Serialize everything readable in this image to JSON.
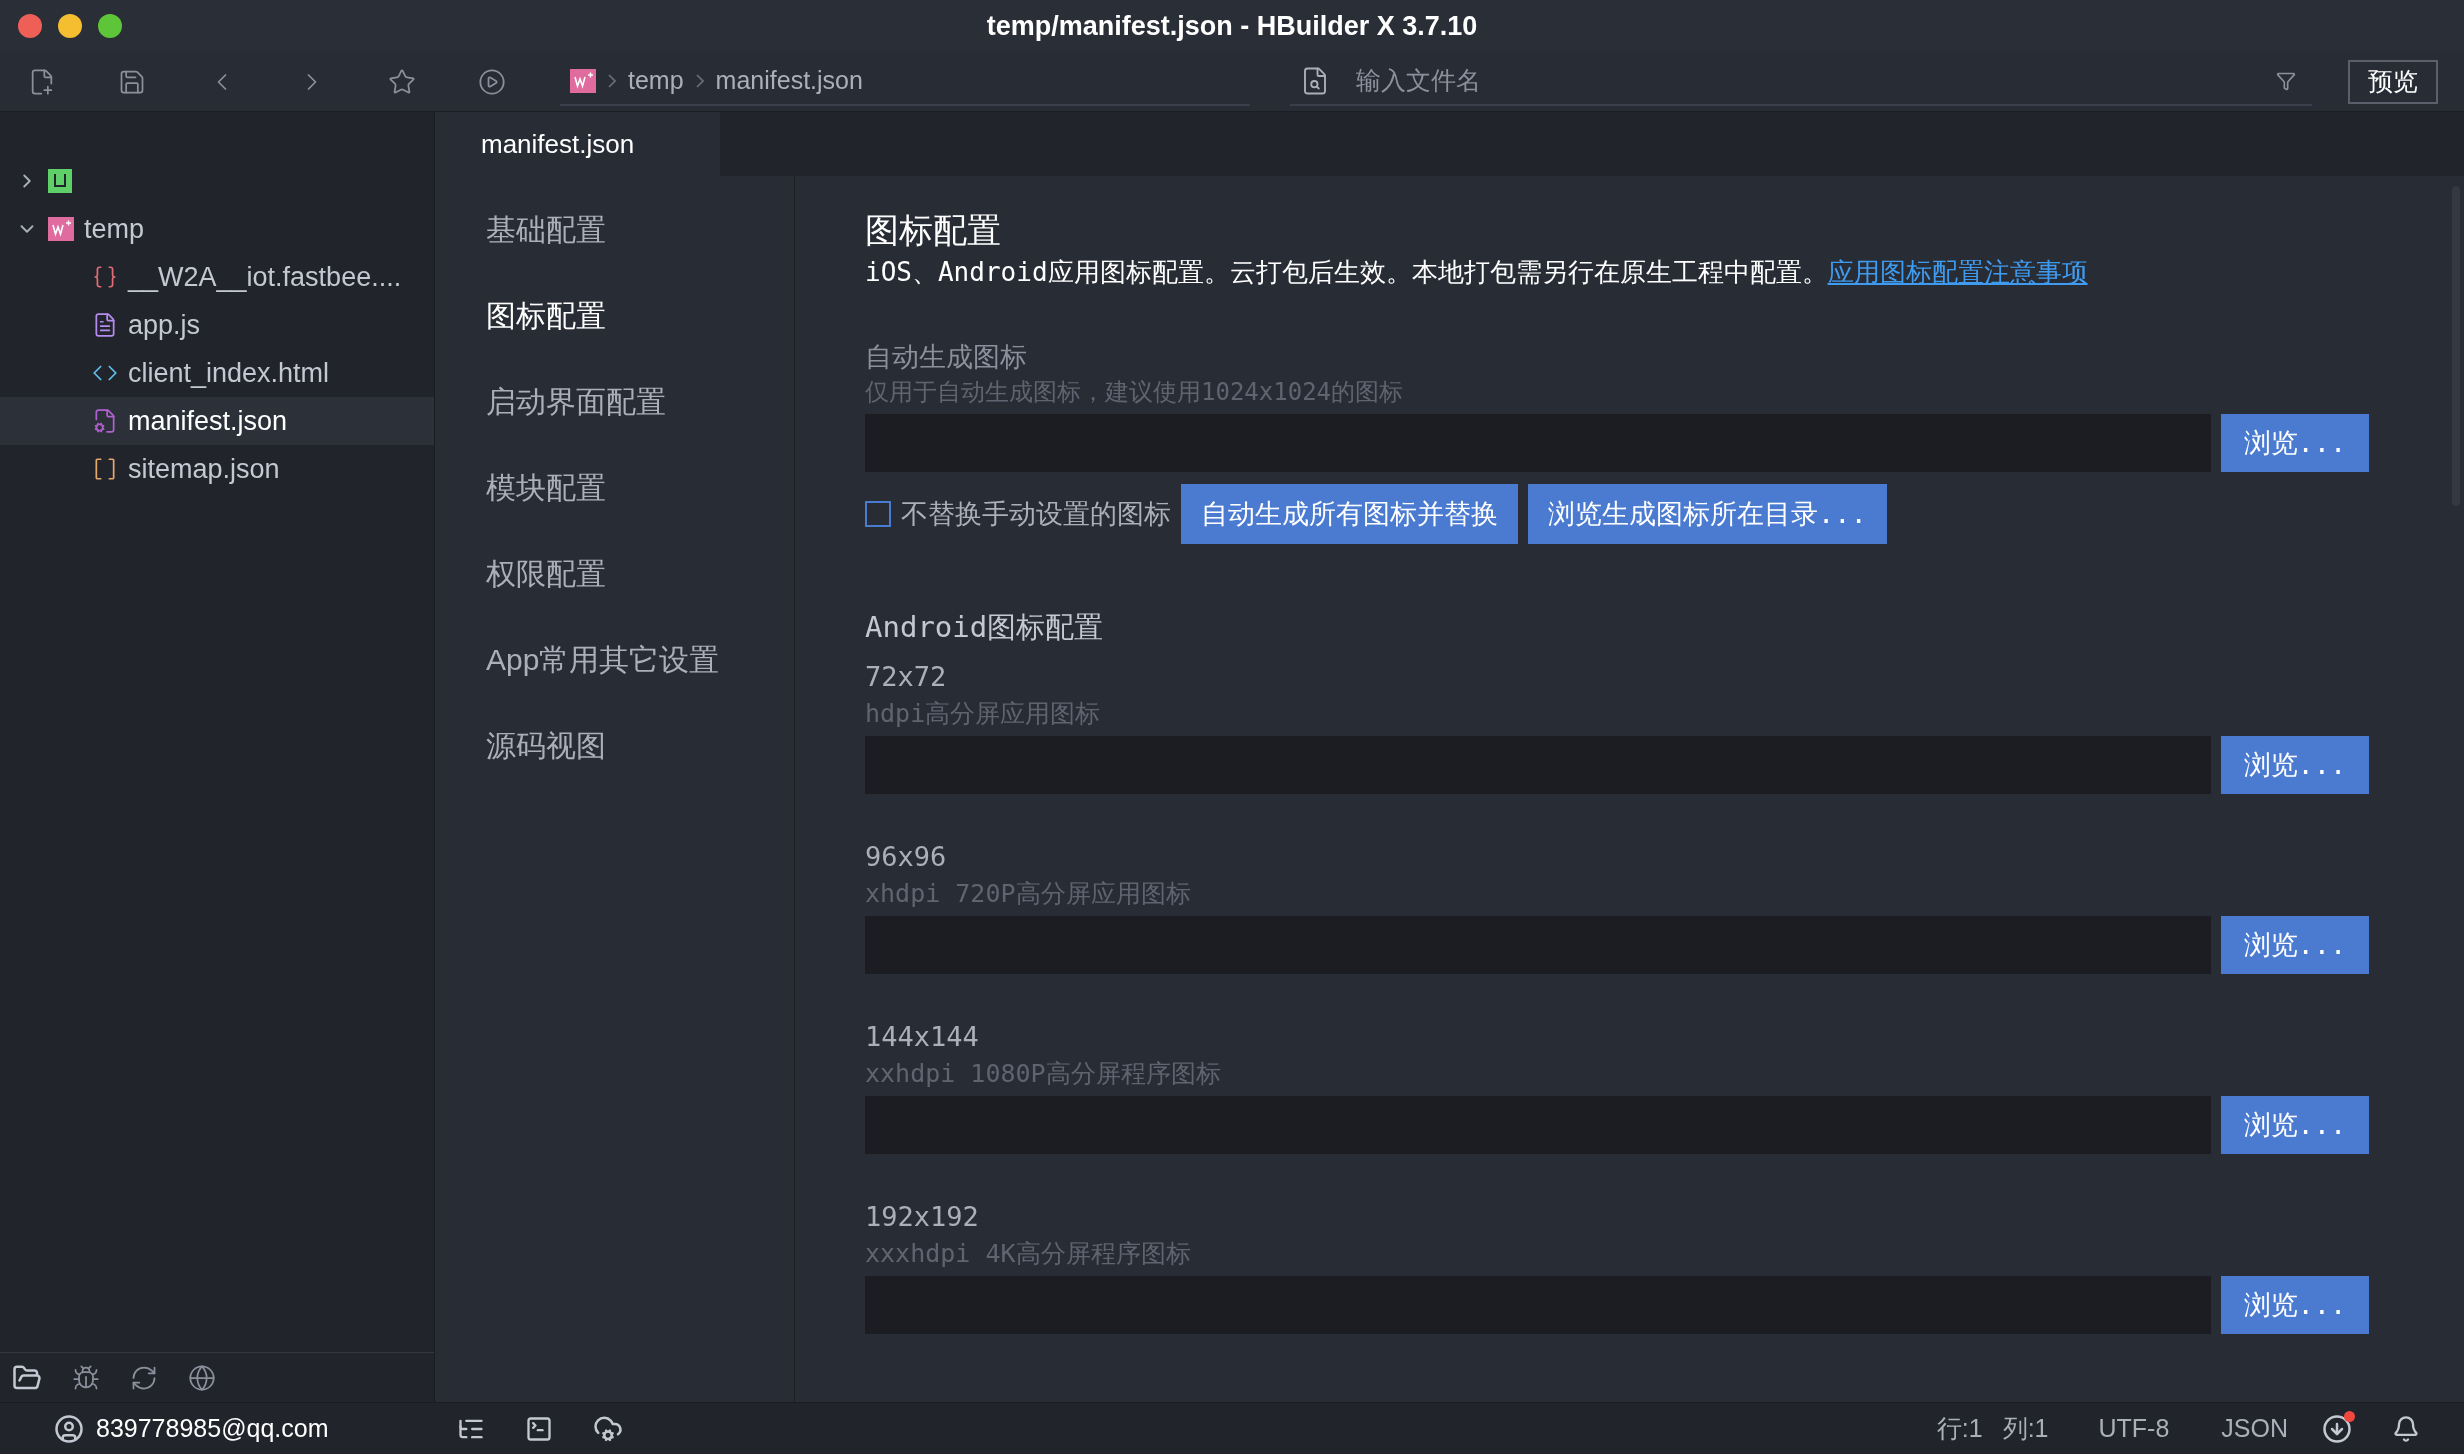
{
  "window": {
    "title": "temp/manifest.json - HBuilder X 3.7.10"
  },
  "toolbar": {
    "breadcrumb": [
      "temp",
      "manifest.json"
    ],
    "search": {
      "placeholder": "输入文件名"
    },
    "preview_button": "预览"
  },
  "project_tree": [
    {
      "kind": "uniapp",
      "expanded": false,
      "selected": false
    },
    {
      "kind": "project",
      "label": "temp",
      "expanded": true,
      "selected": false,
      "children": [
        {
          "kind": "braces",
          "label": "__W2A__iot.fastbee....",
          "selected": false
        },
        {
          "kind": "js",
          "label": "app.js",
          "selected": false
        },
        {
          "kind": "html",
          "label": "client_index.html",
          "selected": false
        },
        {
          "kind": "manifest",
          "label": "manifest.json",
          "selected": true
        },
        {
          "kind": "brackets",
          "label": "sitemap.json",
          "selected": false
        }
      ]
    }
  ],
  "editor_tabs": [
    {
      "label": "manifest.json",
      "selected": true
    }
  ],
  "settings_nav": [
    {
      "label": "基础配置",
      "selected": false
    },
    {
      "label": "图标配置",
      "selected": true
    },
    {
      "label": "启动界面配置",
      "selected": false
    },
    {
      "label": "模块配置",
      "selected": false
    },
    {
      "label": "权限配置",
      "selected": false
    },
    {
      "label": "App常用其它设置",
      "selected": false
    },
    {
      "label": "源码视图",
      "selected": false
    }
  ],
  "content": {
    "title": "图标配置",
    "description": "iOS、Android应用图标配置。云打包后生效。本地打包需另行在原生工程中配置。",
    "link": "应用图标配置注意事项",
    "auto_generate": {
      "label": "自动生成图标",
      "hint": "仅用于自动生成图标，建议使用1024x1024的图标",
      "browse_button": "浏览...",
      "checkbox": {
        "label": "不替换手动设置的图标",
        "checked": false
      },
      "buttons": [
        "自动生成所有图标并替换",
        "浏览生成图标所在目录..."
      ]
    },
    "android": {
      "title": "Android图标配置",
      "icons": [
        {
          "size": "72x72",
          "hint": "hdpi高分屏应用图标",
          "browse_button": "浏览..."
        },
        {
          "size": "96x96",
          "hint": "xhdpi 720P高分屏应用图标",
          "browse_button": "浏览..."
        },
        {
          "size": "144x144",
          "hint": "xxhdpi 1080P高分屏程序图标",
          "browse_button": "浏览..."
        },
        {
          "size": "192x192",
          "hint": "xxxhdpi 4K高分屏程序图标",
          "browse_button": "浏览..."
        }
      ]
    }
  },
  "status_bar": {
    "account": "839778985@qq.com",
    "line": "行:1",
    "column": "列:1",
    "encoding": "UTF-8",
    "language": "JSON"
  }
}
